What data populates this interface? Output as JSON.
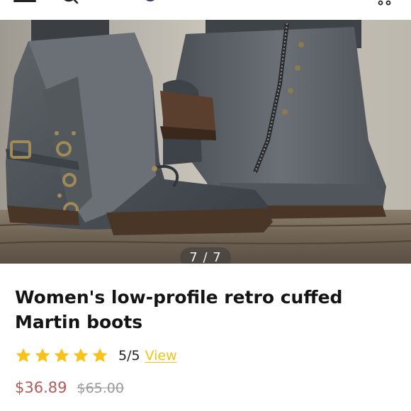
{
  "header": {
    "menu_icon": "hamburger-icon",
    "search_icon": "search-icon",
    "logo_icon": "brand-logo",
    "cart_icon": "cart-icon"
  },
  "gallery": {
    "counter": "7 / 7"
  },
  "product": {
    "title": "Women's low-profile retro cuffed Martin boots",
    "rating": {
      "stars": 5,
      "text": "5/5",
      "link": "View"
    },
    "price": "$36.89",
    "original_price": "$65.00"
  },
  "colors": {
    "star": "#f7c219",
    "link": "#f0c419",
    "sale_price": "#b15a5a",
    "original_price": "#9a9a9a"
  }
}
